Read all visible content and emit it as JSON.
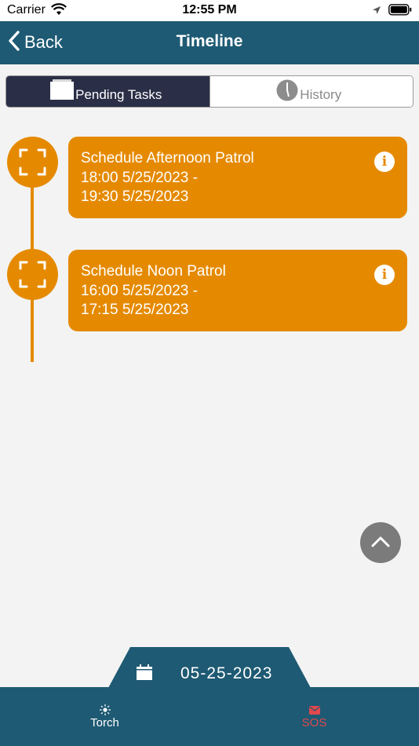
{
  "status_bar": {
    "carrier": "Carrier",
    "time": "12:55 PM"
  },
  "nav": {
    "back_label": "Back",
    "title": "Timeline"
  },
  "segments": [
    {
      "label": "Pending Tasks",
      "active": true
    },
    {
      "label": "History",
      "active": false
    }
  ],
  "tasks": [
    {
      "title": "Schedule Afternoon Patrol",
      "start": "18:00 5/25/2023 -",
      "end": "19:30 5/25/2023"
    },
    {
      "title": "Schedule Noon Patrol",
      "start": "16:00 5/25/2023 -",
      "end": "17:15 5/25/2023"
    }
  ],
  "info_glyph": "i",
  "date_bar": {
    "date": "05-25-2023"
  },
  "tab_bar": [
    {
      "label": "Torch",
      "icon": "sun-icon",
      "color": "#ffffff"
    },
    {
      "label": "SOS",
      "icon": "mail-icon",
      "color": "#e0484e"
    }
  ],
  "colors": {
    "nav_bg": "#1e5a73",
    "accent_orange": "#e58a00",
    "segment_active_bg": "#2a2e46",
    "page_bg": "#f3f3f3",
    "scroll_button": "#7b7b7b",
    "sos_red": "#e0484e"
  }
}
